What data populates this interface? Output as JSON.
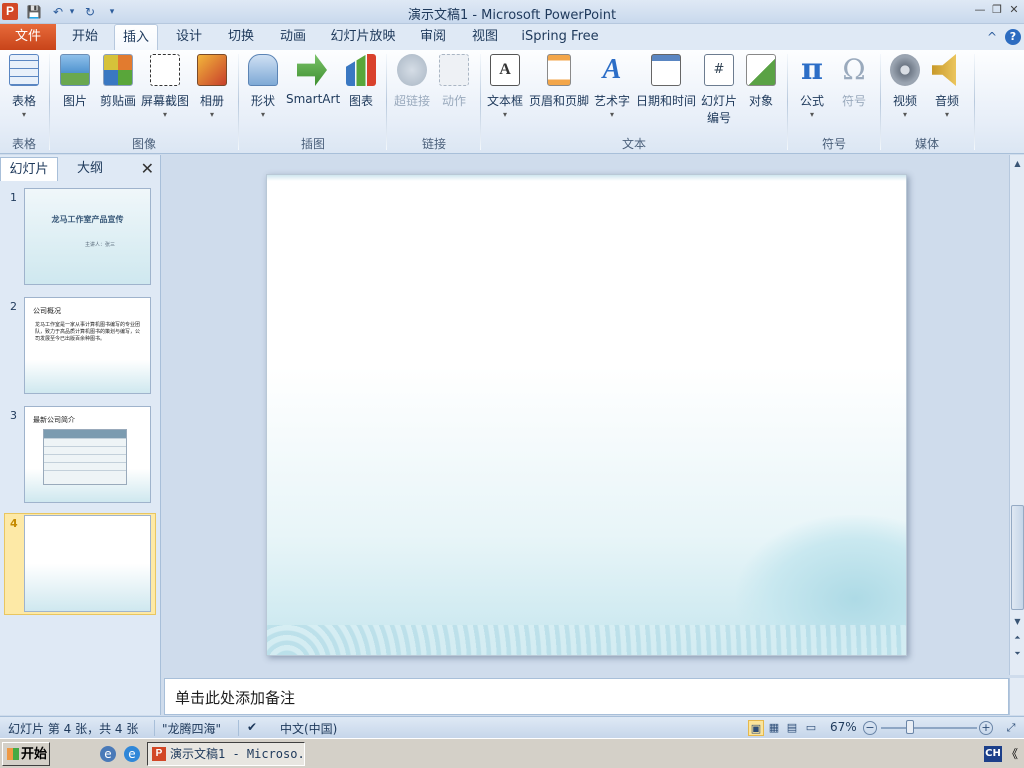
{
  "window": {
    "title": "演示文稿1 - Microsoft PowerPoint",
    "app_icon_letter": "P",
    "qat": {
      "save": "💾",
      "undo": "↶",
      "redo": "↻",
      "customize": "▾"
    },
    "controls": {
      "minimize": "—",
      "restore": "❐",
      "close": "✕"
    }
  },
  "tabs": {
    "file": "文件",
    "items": [
      "开始",
      "插入",
      "设计",
      "切换",
      "动画",
      "幻灯片放映",
      "审阅",
      "视图",
      "iSpring Free"
    ],
    "active": "插入",
    "collapse": "^",
    "help": "?"
  },
  "ribbon": {
    "groups": {
      "table": {
        "label": "表格",
        "buttons": [
          "表格"
        ]
      },
      "images": {
        "label": "图像",
        "buttons": [
          "图片",
          "剪贴画",
          "屏幕截图",
          "相册"
        ]
      },
      "illustrations": {
        "label": "插图",
        "buttons": [
          "形状",
          "SmartArt",
          "图表"
        ]
      },
      "links": {
        "label": "链接",
        "buttons": [
          "超链接",
          "动作"
        ]
      },
      "text": {
        "label": "文本",
        "buttons": [
          "文本框",
          "页眉和页脚",
          "艺术字",
          "日期和时间",
          "幻灯片",
          "编号",
          "对象"
        ]
      },
      "symbols": {
        "label": "符号",
        "buttons": [
          "公式",
          "符号"
        ]
      },
      "media": {
        "label": "媒体",
        "buttons": [
          "视频",
          "音频"
        ]
      }
    },
    "icon_glyphs": {
      "equation": "π",
      "symbol": "Ω",
      "wordart": "A",
      "textbox": "A",
      "slide_number": "#"
    }
  },
  "left_pane": {
    "tabs": [
      "幻灯片",
      "大纲"
    ],
    "close": "✕",
    "thumbnails": [
      {
        "num": "1",
        "title": "龙马工作室产品宣传",
        "sub": "主讲人：张三"
      },
      {
        "num": "2",
        "heading": "公司概况",
        "body": "龙马工作室是一家从事计算机图书编写的专业团队，致力于高品质计算机图书的策划与编写，公司发展至今已出版百余种图书。"
      },
      {
        "num": "3",
        "heading": "最新公司简介"
      },
      {
        "num": "4"
      }
    ],
    "selected": "4"
  },
  "notes": {
    "placeholder": "单击此处添加备注"
  },
  "status": {
    "slide_info": "幻灯片 第 4 张，共 4 张",
    "theme": "\"龙腾四海\"",
    "language": "中文(中国)",
    "zoom": "67%",
    "zoom_minus": "−",
    "zoom_plus": "+"
  },
  "taskbar": {
    "start": "开始",
    "task_label": "演示文稿1 - Microso...",
    "tray_ime": "CH",
    "tray_more": "《"
  },
  "colors": {
    "file_tab": "#d24726",
    "ribbon_text": "#1e395b",
    "selection": "#f4c95b"
  }
}
